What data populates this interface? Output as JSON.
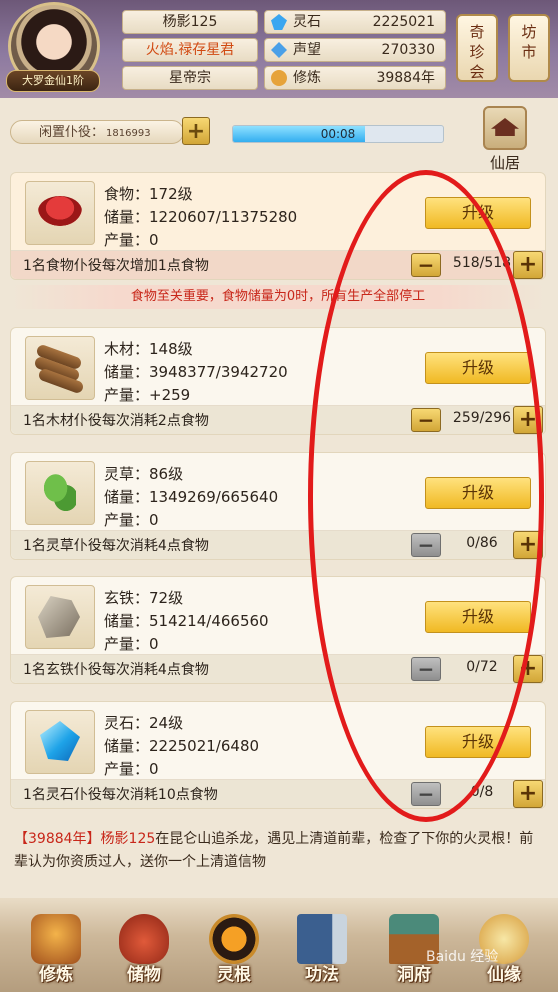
{
  "player": {
    "rank": "大罗金仙1阶",
    "name": "杨影125",
    "title": "火焰.禄存星君",
    "sect": "星帝宗"
  },
  "resources": [
    {
      "label": "灵石",
      "value": "2225021",
      "icon": "spirit-stone-icon",
      "color": "#3aa6f0"
    },
    {
      "label": "声望",
      "value": "270330",
      "icon": "reputation-icon",
      "color": "#4aa0e8"
    },
    {
      "label": "修炼",
      "value": "39884年",
      "icon": "cultivation-icon",
      "color": "#e6a33a"
    }
  ],
  "side_buttons": {
    "treasure": "奇珍会",
    "market": "坊市"
  },
  "servants": {
    "label": "闲置仆役",
    "count": "1816993",
    "timer": "00:08",
    "timer_progress": 0.63
  },
  "xianju": {
    "label": "仙居"
  },
  "warning": "食物至关重要，食物储量为0时，所有生产全部停工",
  "upgrade_label": "升级",
  "items": [
    {
      "level": "食物：172级",
      "storage": "储量：1220607/11375280",
      "output": "产量：0",
      "desc": "1名食物仆役每次增加1点食物",
      "count": "518/518",
      "minus_active": true,
      "icon": "meat-icon"
    },
    {
      "level": "木材：148级",
      "storage": "储量：3948377/3942720",
      "output": "产量：+259",
      "desc": "1名木材仆役每次消耗2点食物",
      "count": "259/296",
      "minus_active": true,
      "icon": "wood-icon"
    },
    {
      "level": "灵草：86级",
      "storage": "储量：1349269/665640",
      "output": "产量：0",
      "desc": "1名灵草仆役每次消耗4点食物",
      "count": "0/86",
      "minus_active": false,
      "icon": "herb-icon"
    },
    {
      "level": "玄铁：72级",
      "storage": "储量：514214/466560",
      "output": "产量：0",
      "desc": "1名玄铁仆役每次消耗4点食物",
      "count": "0/72",
      "minus_active": false,
      "icon": "iron-icon"
    },
    {
      "level": "灵石：24级",
      "storage": "储量：2225021/6480",
      "output": "产量：0",
      "desc": "1名灵石仆役每次消耗10点食物",
      "count": "0/8",
      "minus_active": false,
      "icon": "gem-icon"
    }
  ],
  "log": {
    "year": "【39884年】",
    "name": "杨影125",
    "text": "在昆仑山追杀龙，遇见上清道前辈，检查了下你的火灵根！前辈认为你资质过人，送你一个上清道信物"
  },
  "nav": [
    {
      "label": "修炼",
      "icon": "cultivation-nav-icon"
    },
    {
      "label": "储物",
      "icon": "storage-bag-icon"
    },
    {
      "label": "灵根",
      "icon": "spirit-root-icon"
    },
    {
      "label": "功法",
      "icon": "skill-book-icon"
    },
    {
      "label": "洞府",
      "icon": "cave-house-icon"
    },
    {
      "label": "仙缘",
      "icon": "fate-icon"
    }
  ],
  "watermark": "Baidu 经验"
}
